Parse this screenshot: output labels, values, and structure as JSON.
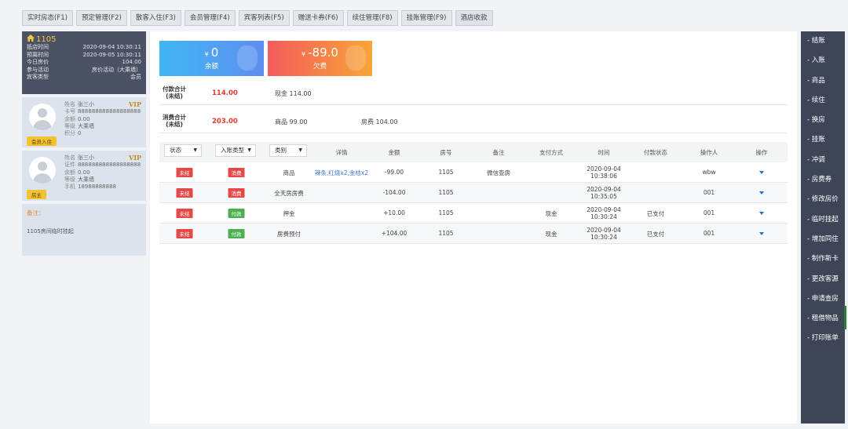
{
  "top_tabs": [
    "实时房态(F1)",
    "预定管理(F2)",
    "散客入住(F3)",
    "会员管理(F4)",
    "宾客列表(F5)",
    "赠送卡券(F6)",
    "续住管理(F8)",
    "挂账管理(F9)",
    "酒店收款"
  ],
  "room": {
    "number": "1105",
    "rows": [
      {
        "k": "抵店时间",
        "v": "2020-09-04 10:30:11"
      },
      {
        "k": "预离时间",
        "v": "2020-09-05 10:30:11"
      },
      {
        "k": "今日房价",
        "v": "104.00"
      },
      {
        "k": "参与活动",
        "v": "房价活动（大乘墙）"
      },
      {
        "k": "宾客类型",
        "v": "会员"
      }
    ]
  },
  "guests": [
    {
      "vip": "VIP",
      "rows": [
        {
          "k": "姓名",
          "v": "张三小"
        },
        {
          "k": "卡号",
          "v": "888888888888888888"
        },
        {
          "k": "余额",
          "v": "0.00"
        },
        {
          "k": "等级",
          "v": "大乘墙"
        },
        {
          "k": "积分",
          "v": "0"
        }
      ],
      "tag": "会员入住"
    },
    {
      "vip": "VIP",
      "rows": [
        {
          "k": "姓名",
          "v": "张三小"
        },
        {
          "k": "证件",
          "v": "888888888888888888"
        },
        {
          "k": "余额",
          "v": "0.00"
        },
        {
          "k": "等级",
          "v": "大乘墙"
        },
        {
          "k": "手机",
          "v": "18988888888"
        }
      ],
      "tag": "房主"
    }
  ],
  "note": {
    "title": "备注：",
    "text": "1105房间临时挂起"
  },
  "cards": {
    "balance": {
      "currency": "¥",
      "value": "0",
      "label": "余额"
    },
    "debt": {
      "currency": "¥",
      "value": "-89.0",
      "label": "欠费"
    }
  },
  "summary": {
    "pay": {
      "h1": "付款合计",
      "h2": "(未结)",
      "amount": "114.00",
      "items": [
        "现金 114.00"
      ]
    },
    "cons": {
      "h1": "消费合计",
      "h2": "(未结)",
      "amount": "203.00",
      "items": [
        "商品  99.00",
        "房费  104.00"
      ]
    }
  },
  "filters": [
    "状态",
    "入账类型",
    "类别"
  ],
  "columns": [
    "详情",
    "金额",
    "房号",
    "备注",
    "支付方式",
    "时间",
    "付款状态",
    "操作人",
    "操作"
  ],
  "rows": [
    {
      "status": "未结",
      "type": "消费",
      "type_color": "red",
      "cat": "商品",
      "detail": "辣条,红烧x2,金桔x2",
      "amount": "-99.00",
      "room": "1105",
      "remark": "微信查房",
      "pay": "",
      "date": "2020-09-04",
      "time": "10:38:06",
      "pstate": "",
      "op": "wbw"
    },
    {
      "status": "未结",
      "type": "消费",
      "type_color": "red",
      "cat": "全天房房费",
      "detail": "",
      "amount": "-104.00",
      "room": "1105",
      "remark": "",
      "pay": "",
      "date": "2020-09-04",
      "time": "10:35:05",
      "pstate": "",
      "op": "001"
    },
    {
      "status": "未结",
      "type": "付款",
      "type_color": "green",
      "cat": "押金",
      "detail": "",
      "amount": "+10.00",
      "room": "1105",
      "remark": "",
      "pay": "现金",
      "date": "2020-09-04",
      "time": "10:30:24",
      "pstate": "已支付",
      "op": "001"
    },
    {
      "status": "未结",
      "type": "付款",
      "type_color": "green",
      "cat": "房费预付",
      "detail": "",
      "amount": "+104.00",
      "room": "1105",
      "remark": "",
      "pay": "现金",
      "date": "2020-09-04",
      "time": "10:30:24",
      "pstate": "已支付",
      "op": "001"
    }
  ],
  "sidebar": [
    "- 结账",
    "- 入账",
    "- 商品",
    "- 续住",
    "- 换房",
    "- 挂账",
    "- 冲调",
    "- 房费券",
    "- 修改房价",
    "- 临时挂起",
    "- 增加同住",
    "- 制作新卡",
    "- 更改客源",
    "- 申请查房",
    "- 租借物品",
    "- 打印账单"
  ]
}
